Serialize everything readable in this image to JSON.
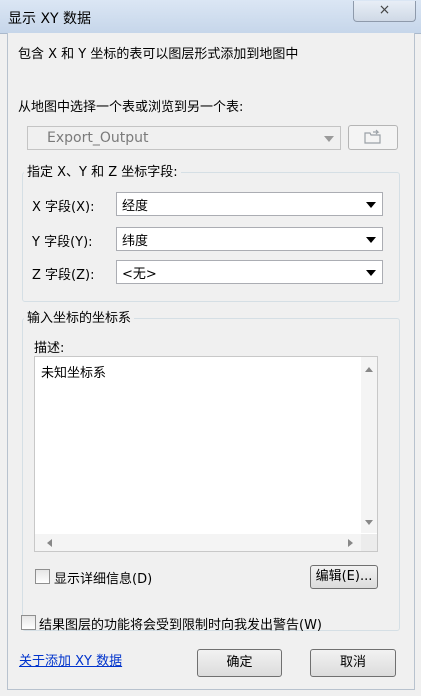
{
  "window": {
    "title": "显示 XY 数据",
    "close_icon": "×"
  },
  "intro_text": "包含 X 和 Y 坐标的表可以图层形式添加到地图中",
  "table_select": {
    "label": "从地图中选择一个表或浏览到另一个表:",
    "value": "Export_Output",
    "browse_icon": "open-folder-icon"
  },
  "fields_group": {
    "title": "指定 X、Y 和 Z 坐标字段:",
    "x": {
      "label": "X 字段(X):",
      "value": "经度"
    },
    "y": {
      "label": "Y 字段(Y):",
      "value": "纬度"
    },
    "z": {
      "label": "Z 字段(Z):",
      "value": "<无>"
    }
  },
  "coord_group": {
    "title": "输入坐标的坐标系",
    "description_label": "描述:",
    "description_text": "未知坐标系",
    "show_details_label": "显示详细信息(D)",
    "show_details_checked": false,
    "edit_button": "编辑(E)..."
  },
  "warn_checkbox": {
    "label": "结果图层的功能将会受到限制时向我发出警告(W)",
    "checked": false
  },
  "about_link": "关于添加 XY 数据",
  "ok_button": "确定",
  "cancel_button": "取消",
  "colors": {
    "link": "#0033cc",
    "titlebar": "#c6d6ea",
    "dialog_bg": "#f0f0f0"
  }
}
